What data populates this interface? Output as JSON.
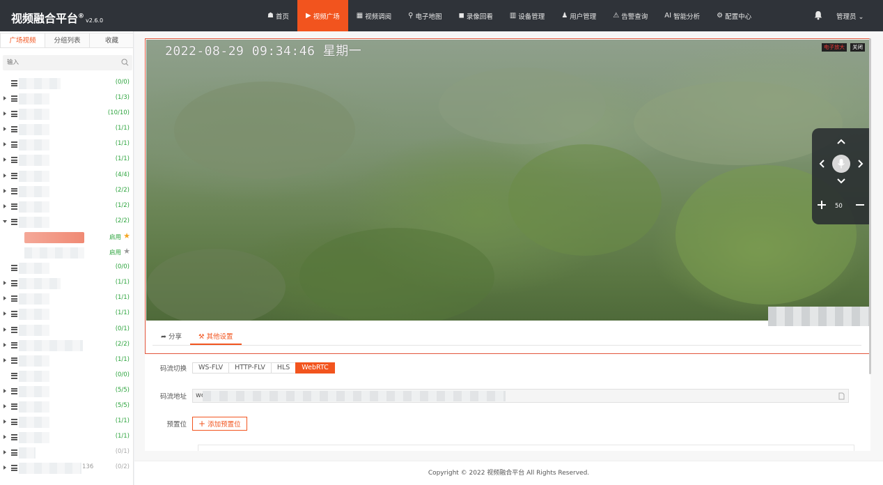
{
  "app": {
    "brand": "视频融合平台",
    "brand_mark": "®",
    "version": "v2.6.0"
  },
  "nav": {
    "items": [
      {
        "label": "首页",
        "icon": "home-icon",
        "glyph": "☗"
      },
      {
        "label": "视频广场",
        "icon": "play-circle-icon",
        "glyph": "▶"
      },
      {
        "label": "视频调阅",
        "icon": "grid-icon",
        "glyph": "▦"
      },
      {
        "label": "电子地图",
        "icon": "map-pin-icon",
        "glyph": "⚲"
      },
      {
        "label": "录像回看",
        "icon": "video-camera-icon",
        "glyph": "◼"
      },
      {
        "label": "设备管理",
        "icon": "device-icon",
        "glyph": "▥"
      },
      {
        "label": "用户管理",
        "icon": "user-icon",
        "glyph": "♟"
      },
      {
        "label": "告警查询",
        "icon": "alarm-icon",
        "glyph": "⚠"
      },
      {
        "label": "智能分析",
        "icon": "ai-icon",
        "glyph": "AI"
      },
      {
        "label": "配置中心",
        "icon": "gear-icon",
        "glyph": "⚙"
      }
    ],
    "active_index": 1,
    "active_color": "#f2541e",
    "user_label": "管理员"
  },
  "sidebar": {
    "tabs": [
      {
        "label": "广场视频",
        "active": true
      },
      {
        "label": "分组列表",
        "active": false
      },
      {
        "label": "收藏",
        "active": false
      }
    ],
    "search_placeholder": "输入",
    "tree": [
      {
        "count": "(0/0)",
        "arrow": "none"
      },
      {
        "count": "(1/3)",
        "arrow": "right"
      },
      {
        "count": "(10/10)",
        "arrow": "right"
      },
      {
        "count": "(1/1)",
        "arrow": "right"
      },
      {
        "count": "(1/1)",
        "arrow": "right"
      },
      {
        "count": "(1/1)",
        "arrow": "right"
      },
      {
        "count": "(4/4)",
        "arrow": "right"
      },
      {
        "count": "(2/2)",
        "arrow": "right"
      },
      {
        "count": "(1/2)",
        "arrow": "right"
      },
      {
        "count": "(2/2)",
        "arrow": "down"
      },
      {
        "type": "channel",
        "status": "启用",
        "starred": true,
        "selected": true
      },
      {
        "type": "channel",
        "status": "启用",
        "starred": false,
        "selected": false
      },
      {
        "count": "(0/0)",
        "arrow": "none"
      },
      {
        "count": "(1/1)",
        "arrow": "right"
      },
      {
        "count": "(1/1)",
        "arrow": "right"
      },
      {
        "count": "(1/1)",
        "arrow": "right"
      },
      {
        "count": "(0/1)",
        "arrow": "right"
      },
      {
        "count": "(2/2)",
        "arrow": "right"
      },
      {
        "count": "(1/1)",
        "arrow": "right"
      },
      {
        "count": "(0/0)",
        "arrow": "none"
      },
      {
        "count": "(5/5)",
        "arrow": "right"
      },
      {
        "count": "(5/5)",
        "arrow": "right"
      },
      {
        "count": "(1/1)",
        "arrow": "right"
      },
      {
        "count": "(1/1)",
        "arrow": "right"
      },
      {
        "count": "(0/1)",
        "arrow": "right",
        "gray": true
      },
      {
        "count": "(0/2)",
        "arrow": "right",
        "gray": true,
        "extra": "136"
      }
    ]
  },
  "player": {
    "timestamp": "2022-08-29 09:34:46 星期一",
    "zoom_label": "电子放大",
    "close_label": "关闭",
    "ptz_zoom_value": "50"
  },
  "detail_tabs": [
    {
      "label": "分享",
      "icon": "share-icon",
      "active": false
    },
    {
      "label": "其他设置",
      "icon": "tools-icon",
      "active": true
    }
  ],
  "stream": {
    "switch_label": "码流切换",
    "options": [
      "WS-FLV",
      "HTTP-FLV",
      "HLS",
      "WebRTC"
    ],
    "active_option": "WebRTC",
    "address_label": "码流地址",
    "address_value": "we",
    "preset_label": "预置位",
    "add_preset_label": "添加预置位"
  },
  "footer": {
    "copyright": "Copyright © 2022 视频融合平台 All Rights Reserved."
  }
}
